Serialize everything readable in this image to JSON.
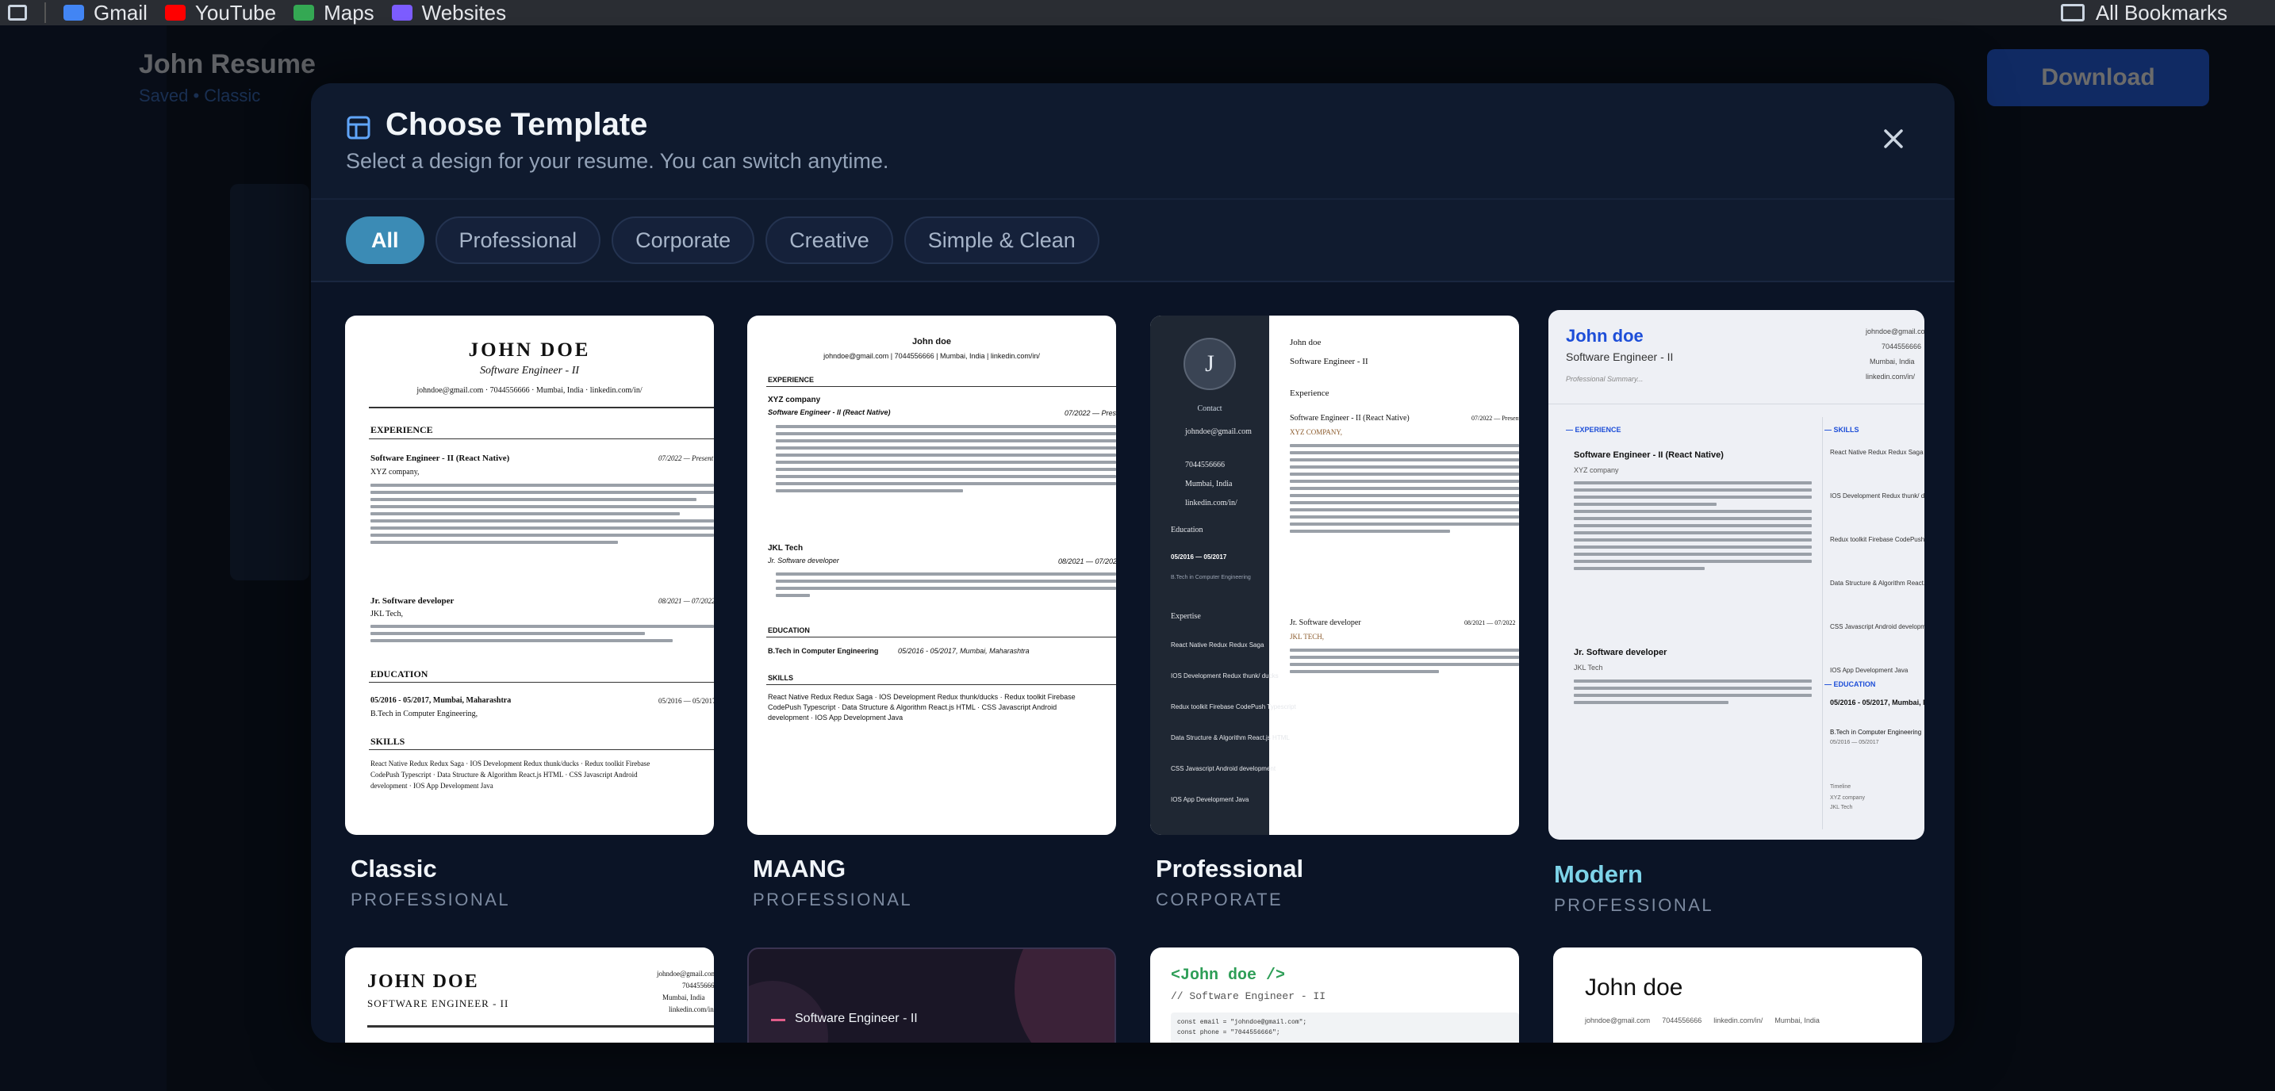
{
  "browser": {
    "bookmarks": [
      {
        "label": "Gmail",
        "icon": "gmail-icon",
        "color": "#4285f4"
      },
      {
        "label": "YouTube",
        "icon": "youtube-icon",
        "color": "#ff0000"
      },
      {
        "label": "Maps",
        "icon": "maps-icon",
        "color": "#34a853"
      },
      {
        "label": "Websites",
        "icon": "websites-icon",
        "color": "#7c5cff"
      }
    ],
    "all_bookmarks": "All Bookmarks"
  },
  "background_app": {
    "title": "John Resume",
    "subtitle": "Saved • Classic",
    "download_label": "Download"
  },
  "modal": {
    "title": "Choose Template",
    "subtitle": "Select a design for your resume. You can switch anytime.",
    "filters": [
      "All",
      "Professional",
      "Corporate",
      "Creative",
      "Simple & Clean"
    ],
    "active_filter": "All",
    "templates": [
      {
        "name": "Classic",
        "category": "PROFESSIONAL"
      },
      {
        "name": "MAANG",
        "category": "PROFESSIONAL"
      },
      {
        "name": "Professional",
        "category": "CORPORATE"
      },
      {
        "name": "Modern",
        "category": "PROFESSIONAL",
        "hovered": true
      }
    ],
    "accent_color": "#3b8bb5",
    "modern_accent": "#1d4ed8"
  },
  "preview": {
    "name_upper": "JOHN DOE",
    "name": "John doe",
    "role": "Software Engineer - II",
    "role_upper": "SOFTWARE ENGINEER - II",
    "email": "johndoe@gmail.com",
    "phone": "7044556666",
    "location": "Mumbai, India",
    "location_short": "Mumbai, Maharashtra",
    "linkedin": "linkedin.com/in/",
    "experience": "EXPERIENCE",
    "experience_title": "Experience",
    "job1_title": "Software Engineer - II (React Native)",
    "job1_company": "XYZ company,",
    "job1_company_plain": "XYZ company",
    "job1_company_upper": "XYZ COMPANY,",
    "job1_date": "07/2022 — Present",
    "job2_title": "Jr. Software developer",
    "job2_company": "JKL Tech,",
    "job2_company_plain": "JKL Tech",
    "job2_company_upper": "JKL TECH,",
    "job2_date": "08/2021 — 07/2022",
    "education": "EDUCATION",
    "education_title": "Education",
    "edu_line": "05/2016 - 05/2017, Mumbai, Maharashtra",
    "edu_date": "05/2016 — 05/2017",
    "degree": "B.Tech in Computer Engineering,",
    "degree_plain": "B.Tech in Computer Engineering",
    "skills": "SKILLS",
    "skills_text1": "React Native Redux Redux Saga · IOS Development Redux thunk/ducks · Redux toolkit Firebase",
    "skills_text2": "CodePush Typescript · Data Structure & Algorithm React.js HTML · CSS Javascript Android",
    "skills_text3": "development · IOS App Development Java",
    "contact": "Contact",
    "expertise": "Expertise",
    "expertise_items": [
      "React Native Redux Redux Saga",
      "IOS Development Redux thunk/ ducks",
      "Redux toolkit Firebase CodePush Typescript",
      "Data Structure & Algorithm React.js HTML",
      "CSS Javascript Android development",
      "IOS App Development Java"
    ],
    "professional_summary": "Professional Summary...",
    "timeline": "Timeline",
    "code_line1": "<John doe />",
    "code_line2": "// Software Engineer - II",
    "code_line3": "const email = \"johndoe@gmail.com\";",
    "code_line4": "const phone = \"7044556666\";",
    "initial": "J"
  }
}
